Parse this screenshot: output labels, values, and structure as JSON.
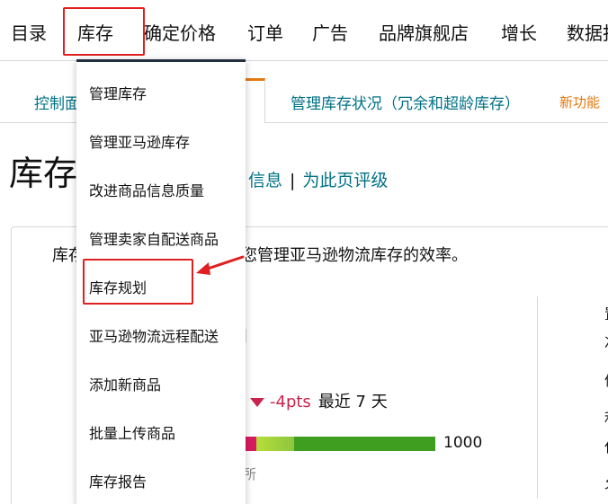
{
  "topnav": {
    "items": [
      "目录",
      "库存",
      "确定价格",
      "订单",
      "广告",
      "品牌旗舰店",
      "增长",
      "数据报"
    ]
  },
  "tabs": {
    "items": [
      "控制面",
      "管理库存状况（冗余和超龄库存）"
    ],
    "new_badge": "新功能"
  },
  "page": {
    "title": "库存",
    "link_info": "信息",
    "separator": "|",
    "link_rate": "为此页评级"
  },
  "card": {
    "intro_prefix": "库存",
    "intro_suffix": "您管理亚马逊物流库存的效率。",
    "score_delta": "-4pts",
    "score_period": "最近 7 天",
    "bar_max_label": "1000",
    "bar_cut_label": "所",
    "side_cut_label": "]",
    "right_edge_chars": [
      "置",
      "次",
      "信",
      "利",
      "仅",
      "允"
    ]
  },
  "dropdown": {
    "items": [
      "管理库存",
      "管理亚马逊库存",
      "改进商品信息质量",
      "管理卖家自配送商品",
      "库存规划",
      "亚马逊物流远程配送",
      "添加新商品",
      "批量上传商品",
      "库存报告"
    ]
  },
  "colors": {
    "link": "#007185",
    "highlight": "#e02020",
    "accent": "#e47911",
    "delta": "#c7254e"
  }
}
